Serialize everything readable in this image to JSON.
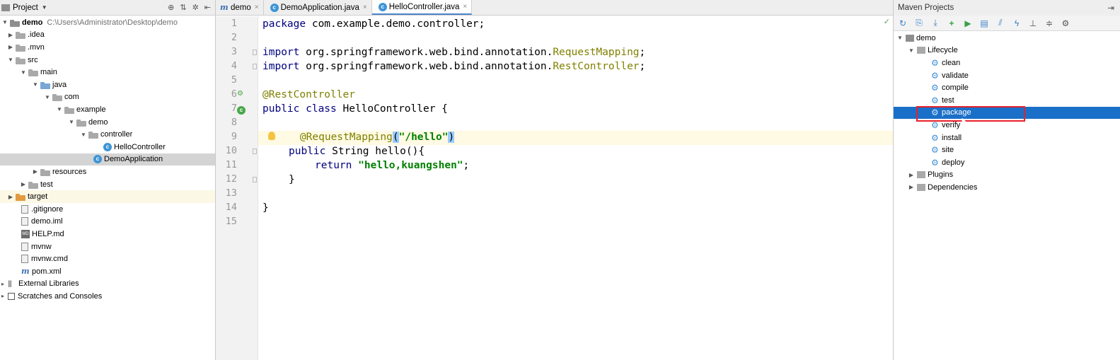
{
  "project_panel": {
    "title": "Project",
    "tree": [
      {
        "label": "demo",
        "path": "C:\\Users\\Administrator\\Desktop\\demo"
      },
      {
        "label": ".idea"
      },
      {
        "label": ".mvn"
      },
      {
        "label": "src"
      },
      {
        "label": "main"
      },
      {
        "label": "java"
      },
      {
        "label": "com"
      },
      {
        "label": "example"
      },
      {
        "label": "demo"
      },
      {
        "label": "controller"
      },
      {
        "label": "HelloController"
      },
      {
        "label": "DemoApplication"
      },
      {
        "label": "resources"
      },
      {
        "label": "test"
      },
      {
        "label": "target"
      },
      {
        "label": ".gitignore"
      },
      {
        "label": "demo.iml"
      },
      {
        "label": "HELP.md"
      },
      {
        "label": "mvnw"
      },
      {
        "label": "mvnw.cmd"
      },
      {
        "label": "pom.xml"
      },
      {
        "label": "External Libraries"
      },
      {
        "label": "Scratches and Consoles"
      }
    ]
  },
  "editor": {
    "tabs": [
      {
        "label": "demo",
        "icon": "maven-m-icon"
      },
      {
        "label": "DemoApplication.java",
        "icon": "class-icon"
      },
      {
        "label": "HelloController.java",
        "icon": "class-icon"
      }
    ],
    "line_numbers": [
      "1",
      "2",
      "3",
      "4",
      "5",
      "6",
      "7",
      "8",
      "9",
      "10",
      "11",
      "12",
      "13",
      "14",
      "15"
    ],
    "code": {
      "l1_kw": "package",
      "l1_rest": " com.example.demo.controller;",
      "l3_kw": "import",
      "l3_pkg": " org.springframework.web.bind.annotation.",
      "l3_cls": "RequestMapping",
      "l3_end": ";",
      "l4_kw": "import",
      "l4_pkg": " org.springframework.web.bind.annotation.",
      "l4_cls": "RestController",
      "l4_end": ";",
      "l6_ann": "@RestController",
      "l7_kw": "public class",
      "l7_rest": " HelloController {",
      "l9_ann": "@RequestMapping",
      "l9_open": "(",
      "l9_str": "\"/hello\"",
      "l9_close": ")",
      "l10_kw": "public",
      "l10_rest": " String hello(){",
      "l11_kw": "return",
      "l11_str": "\"hello,kuangshen\"",
      "l11_end": ";",
      "l12": "}",
      "l14": "}"
    }
  },
  "maven_panel": {
    "title": "Maven Projects",
    "tree": {
      "root": "demo",
      "lifecycle": "Lifecycle",
      "goals": [
        "clean",
        "validate",
        "compile",
        "test",
        "package",
        "verify",
        "install",
        "site",
        "deploy"
      ],
      "selected_goal": "package",
      "plugins": "Plugins",
      "dependencies": "Dependencies"
    }
  },
  "colors": {
    "selection": "#1a6fc8",
    "annotation_box": "#e8202a",
    "keyword": "#000080",
    "annotation": "#808000",
    "string": "#008000"
  }
}
